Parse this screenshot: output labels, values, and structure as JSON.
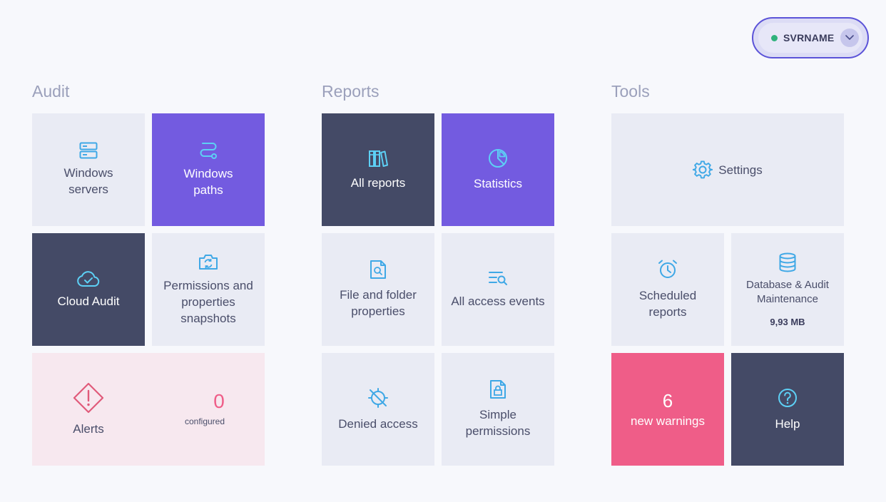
{
  "server": {
    "name": "SVRNAME",
    "status_color": "#2fb27c"
  },
  "sections": {
    "audit": "Audit",
    "reports": "Reports",
    "tools": "Tools"
  },
  "audit": {
    "windows_servers": [
      "Windows",
      "servers"
    ],
    "windows_paths": [
      "Windows",
      "paths"
    ],
    "cloud_audit": "Cloud Audit",
    "snapshots": [
      "Permissions and",
      "properties",
      "snapshots"
    ],
    "alerts": {
      "label": "Alerts",
      "count": "0",
      "count_label": "configured"
    }
  },
  "reports": {
    "all_reports": "All reports",
    "statistics": "Statistics",
    "file_folder": [
      "File and folder",
      "properties"
    ],
    "all_access_events": "All access events",
    "denied_access": "Denied access",
    "simple_permissions": [
      "Simple",
      "permissions"
    ]
  },
  "tools": {
    "settings": "Settings",
    "scheduled_reports": [
      "Scheduled",
      "reports"
    ],
    "db_maintenance": [
      "Database & Audit",
      "Maintenance"
    ],
    "db_size": "9,93 MB",
    "warnings": {
      "count": "6",
      "label": "new warnings"
    },
    "help": "Help"
  },
  "colors": {
    "accent": "#735be0",
    "dark": "#444a66",
    "light": "#e9ebf4",
    "icon_blue": "#3fa8e6",
    "warning": "#ef5d88",
    "alert_icon": "#e05a7a"
  }
}
